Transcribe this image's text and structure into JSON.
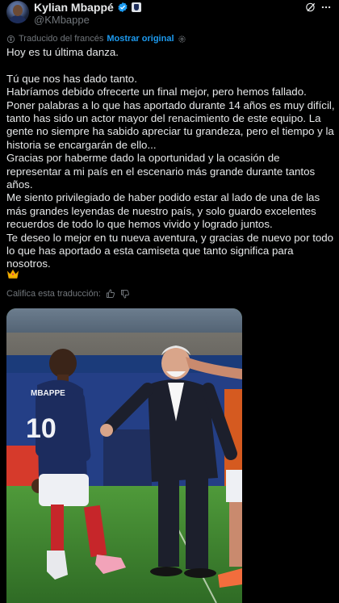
{
  "author": {
    "name": "Kylian Mbappé",
    "handle": "@KMbappe"
  },
  "translation_bar": {
    "label": "Traducido del francés",
    "show_original": "Mostrar original"
  },
  "tweet": {
    "paragraphs": [
      [
        "Hoy es tu última danza."
      ],
      [
        "Tú que nos has dado tanto.",
        "Habríamos debido ofrecerte un final mejor, pero hemos fallado.",
        "Poner palabras a lo que has aportado durante 14 años es muy difícil, tanto has sido un actor mayor del renacimiento de este equipo. La gente no siempre ha sabido apreciar tu grandeza, pero el tiempo y la historia se encargarán de ello...",
        "Gracias por haberme dado la oportunidad y la ocasión de representar a mi país en el escenario más grande durante tantos años.",
        "Me siento privilegiado de haber podido estar al lado de una de las más grandes leyendas de nuestro país, y solo guardo excelentes recuerdos de todo lo que hemos vivido y logrado juntos.",
        "Te deseo lo mejor en tu nueva aventura, y gracias de nuevo por todo lo que has aportado a esta camiseta que tanto significa para nosotros."
      ]
    ],
    "emoji": "crown"
  },
  "rate_translation": {
    "label": "Califica esta traducción:"
  },
  "media": {
    "jersey_name": "MBAPPE",
    "jersey_number": "10"
  },
  "icons": {
    "verified": "verified-badge-icon",
    "org": "affiliate-badge-icon",
    "grok": "grok-icon",
    "more": "more-icon",
    "translate": "translate-icon",
    "settings": "gear-icon",
    "thumbs_up": "thumbs-up-icon",
    "thumbs_down": "thumbs-down-icon",
    "crown": "crown-emoji-icon"
  },
  "colors": {
    "background": "#000000",
    "text": "#e7e9ea",
    "muted": "#71767b",
    "link": "#1d9bf0",
    "verified": "#1d9bf0"
  }
}
